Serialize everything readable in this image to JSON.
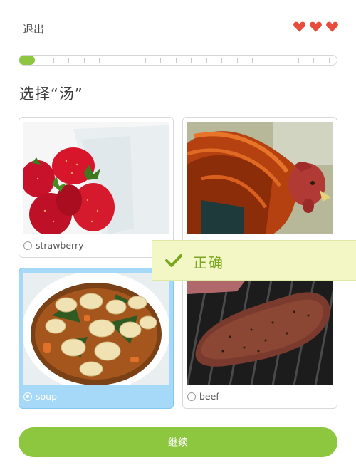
{
  "header": {
    "exit_label": "退出",
    "lives": 3,
    "heart_color": "#e74c3c"
  },
  "progress": {
    "fraction": 0.05,
    "fill_color": "#8dc63f",
    "segments": 20
  },
  "prompt": "选择“汤”",
  "choices": [
    {
      "label": "strawberry",
      "image": "strawberries-photo",
      "selected": false
    },
    {
      "label": "",
      "image": "rooster-photo",
      "selected": false
    },
    {
      "label": "soup",
      "image": "tortellini-soup-photo",
      "selected": true
    },
    {
      "label": "beef",
      "image": "grilled-steak-photo",
      "selected": false
    }
  ],
  "feedback": {
    "text": "正确",
    "icon": "check-icon",
    "color": "#7aa722"
  },
  "continue_label": "继续"
}
